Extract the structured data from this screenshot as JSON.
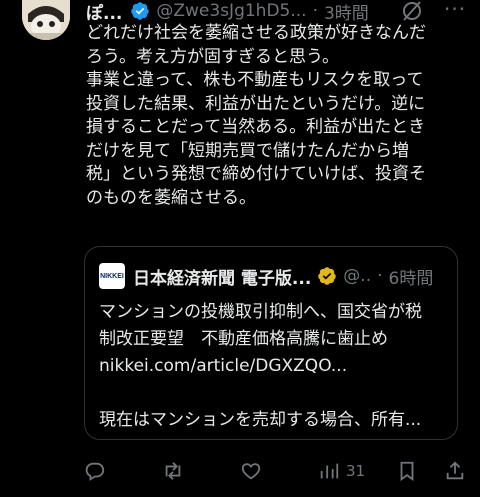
{
  "tweet": {
    "author_name": "ぽ...",
    "handle": "@Zwe3sJg1hD5...",
    "separator": "·",
    "time": "3時間",
    "more_label": "···",
    "lines": [
      "どれだけ社会を萎縮させる政策が好きなんだ",
      "ろう。考え方が固すぎると思う。",
      "事業と違って、株も不動産もリスクを取って",
      "投資した結果、利益が出たというだけ。逆に",
      "損することだって当然ある。利益が出たとき",
      "だけを見て「短期売買で儲けたんだから増",
      "税」という発想で締め付けていけば、投資そ",
      "のものを萎縮させる。"
    ]
  },
  "quote": {
    "logo_text": "NIKKEI",
    "author_name": "日本経済新聞 電子版...",
    "handle": "@..",
    "separator": "·",
    "time": "6時間",
    "lines": [
      "マンションの投機取引抑制へ、国交省が税",
      "制改正要望　不動産価格高騰に歯止め",
      "nikkei.com/article/DGXZQO...",
      "",
      "現在はマンションを売却する場合、所有..."
    ]
  },
  "actions": {
    "reply_count": "",
    "retweet_count": "",
    "like_count": "",
    "views_count": "31"
  },
  "colors": {
    "background": "#000000",
    "text": "#e7e9ea",
    "muted": "#71767b",
    "verified_blue": "#1d9bf0",
    "verified_gold": "#e2b719"
  }
}
